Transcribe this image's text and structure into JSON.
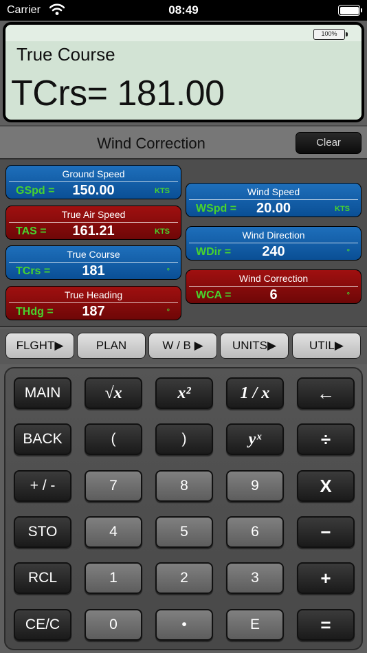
{
  "status": {
    "carrier": "Carrier",
    "time": "08:49"
  },
  "display": {
    "battery": "100%",
    "title": "True Course",
    "value": "TCrs= 181.00"
  },
  "section": {
    "title": "Wind Correction",
    "clear_label": "Clear"
  },
  "fields": {
    "ground_speed": {
      "title": "Ground Speed",
      "label": "GSpd =",
      "value": "150.00",
      "unit": "KTS"
    },
    "true_air_speed": {
      "title": "True Air Speed",
      "label": "TAS =",
      "value": "161.21",
      "unit": "KTS"
    },
    "true_course": {
      "title": "True Course",
      "label": "TCrs =",
      "value": "181",
      "unit": "°"
    },
    "true_heading": {
      "title": "True Heading",
      "label": "THdg =",
      "value": "187",
      "unit": "°"
    },
    "wind_speed": {
      "title": "Wind Speed",
      "label": "WSpd =",
      "value": "20.00",
      "unit": "KTS"
    },
    "wind_direction": {
      "title": "Wind Direction",
      "label": "WDir =",
      "value": "240",
      "unit": "°"
    },
    "wind_correction": {
      "title": "Wind Correction",
      "label": "WCA =",
      "value": "6",
      "unit": "°"
    }
  },
  "nav": {
    "flight": "FLGHT▶",
    "plan": "PLAN",
    "wb": "W / B ▶",
    "units": "UNITS▶",
    "util": "UTIL▶"
  },
  "keys": {
    "main": "MAIN",
    "sqrt": "√x",
    "square": "x²",
    "reciprocal": "1 / x",
    "backspace": "←",
    "back": "BACK",
    "lparen": "(",
    "rparen": ")",
    "power": "yˣ",
    "divide": "÷",
    "plusminus": "+ / -",
    "k7": "7",
    "k8": "8",
    "k9": "9",
    "multiply": "X",
    "sto": "STO",
    "k4": "4",
    "k5": "5",
    "k6": "6",
    "minus": "−",
    "rcl": "RCL",
    "k1": "1",
    "k2": "2",
    "k3": "3",
    "plus": "+",
    "cece": "CE/C",
    "k0": "0",
    "dot": "•",
    "exp": "E",
    "equals": "="
  },
  "colors": {
    "field_blue": "#0a5aa5",
    "field_red": "#8a0b0b",
    "label_green": "#48d32e",
    "lcd_bg": "#d2e3d4"
  }
}
